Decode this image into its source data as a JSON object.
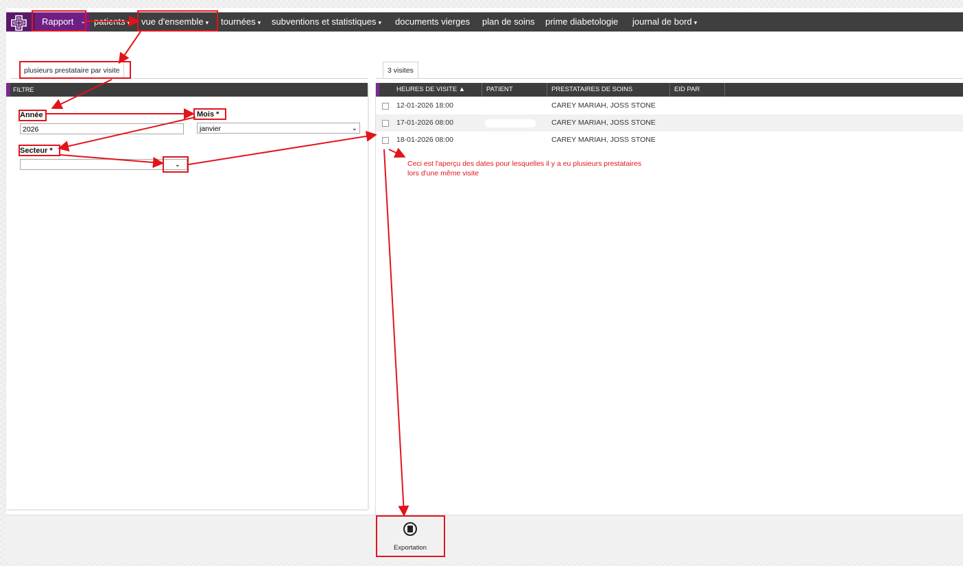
{
  "nav": {
    "rapport": "Rapport",
    "items": [
      {
        "label": "patients",
        "dropdown": true
      },
      {
        "label": "vue d'ensemble",
        "dropdown": true
      },
      {
        "label": "tournées",
        "dropdown": true
      },
      {
        "label": "subventions et statistiques",
        "dropdown": true
      },
      {
        "label": "documents vierges",
        "dropdown": false
      },
      {
        "label": "plan de soins",
        "dropdown": false
      },
      {
        "label": "prime diabetologie",
        "dropdown": false
      },
      {
        "label": "journal de bord",
        "dropdown": true
      }
    ],
    "caret": "▾",
    "chevron": "⌄"
  },
  "left_tab": "plusieurs prestataire par visite",
  "filter": {
    "header": "FILTRE",
    "annee_label": "Année",
    "annee_value": "2026",
    "mois_label": "Mois *",
    "mois_value": "janvier",
    "secteur_label": "Secteur *",
    "secteur_value": "",
    "arrow": "⌄"
  },
  "grid": {
    "tab": "3 visites",
    "columns": [
      "HEURES DE VISITE ▲",
      "PATIENT",
      "PRESTATAIRES DE SOINS",
      "EID PAR"
    ],
    "rows": [
      {
        "date": "12-01-2026 18:00",
        "patient": "",
        "prestataires": "CAREY MARIAH, JOSS STONE"
      },
      {
        "date": "17-01-2026 08:00",
        "patient": "",
        "prestataires": "CAREY MARIAH, JOSS STONE"
      },
      {
        "date": "18-01-2026 08:00",
        "patient": "",
        "prestataires": "CAREY MARIAH, JOSS STONE"
      }
    ]
  },
  "note": {
    "line1": "Ceci est l'aperçu des dates pour lesquelles il y a eu plusieurs prestataires",
    "line2": "lors d'une même visite"
  },
  "export": {
    "label": "Exportation",
    "icon": "excel-icon"
  },
  "colors": {
    "nav_bg": "#3f3f3f",
    "brand": "#6f1f83",
    "annotation": "#e1141a"
  }
}
